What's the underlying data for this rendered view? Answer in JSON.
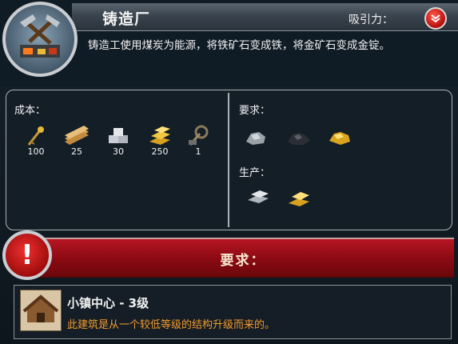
{
  "header": {
    "title": "铸造厂",
    "attractiveness_label": "吸引力：",
    "description": "铸造工使用煤炭为能源，将铁矿石变成铁，将金矿石变成金锭。"
  },
  "cost": {
    "label": "成本：",
    "items": [
      {
        "icon": "scepter-icon",
        "amount": "100"
      },
      {
        "icon": "wood-planks-icon",
        "amount": "25"
      },
      {
        "icon": "stone-blocks-icon",
        "amount": "30"
      },
      {
        "icon": "gold-bars-icon",
        "amount": "250"
      },
      {
        "icon": "tools-icon",
        "amount": "1"
      }
    ]
  },
  "requirements": {
    "label": "要求：",
    "items": [
      {
        "icon": "iron-ore-icon"
      },
      {
        "icon": "coal-icon"
      },
      {
        "icon": "gold-ore-icon"
      }
    ]
  },
  "production": {
    "label": "生产：",
    "items": [
      {
        "icon": "iron-ingot-icon"
      },
      {
        "icon": "gold-ingot-icon"
      }
    ]
  },
  "banner": {
    "label": "要求："
  },
  "prerequisite": {
    "title": "小镇中心 - 3级",
    "description": "此建筑是从一个较低等级的结构升级而来的。"
  },
  "colors": {
    "accent_red": "#b51622",
    "note_orange": "#f29a2e",
    "gold": "#e6b93a"
  }
}
